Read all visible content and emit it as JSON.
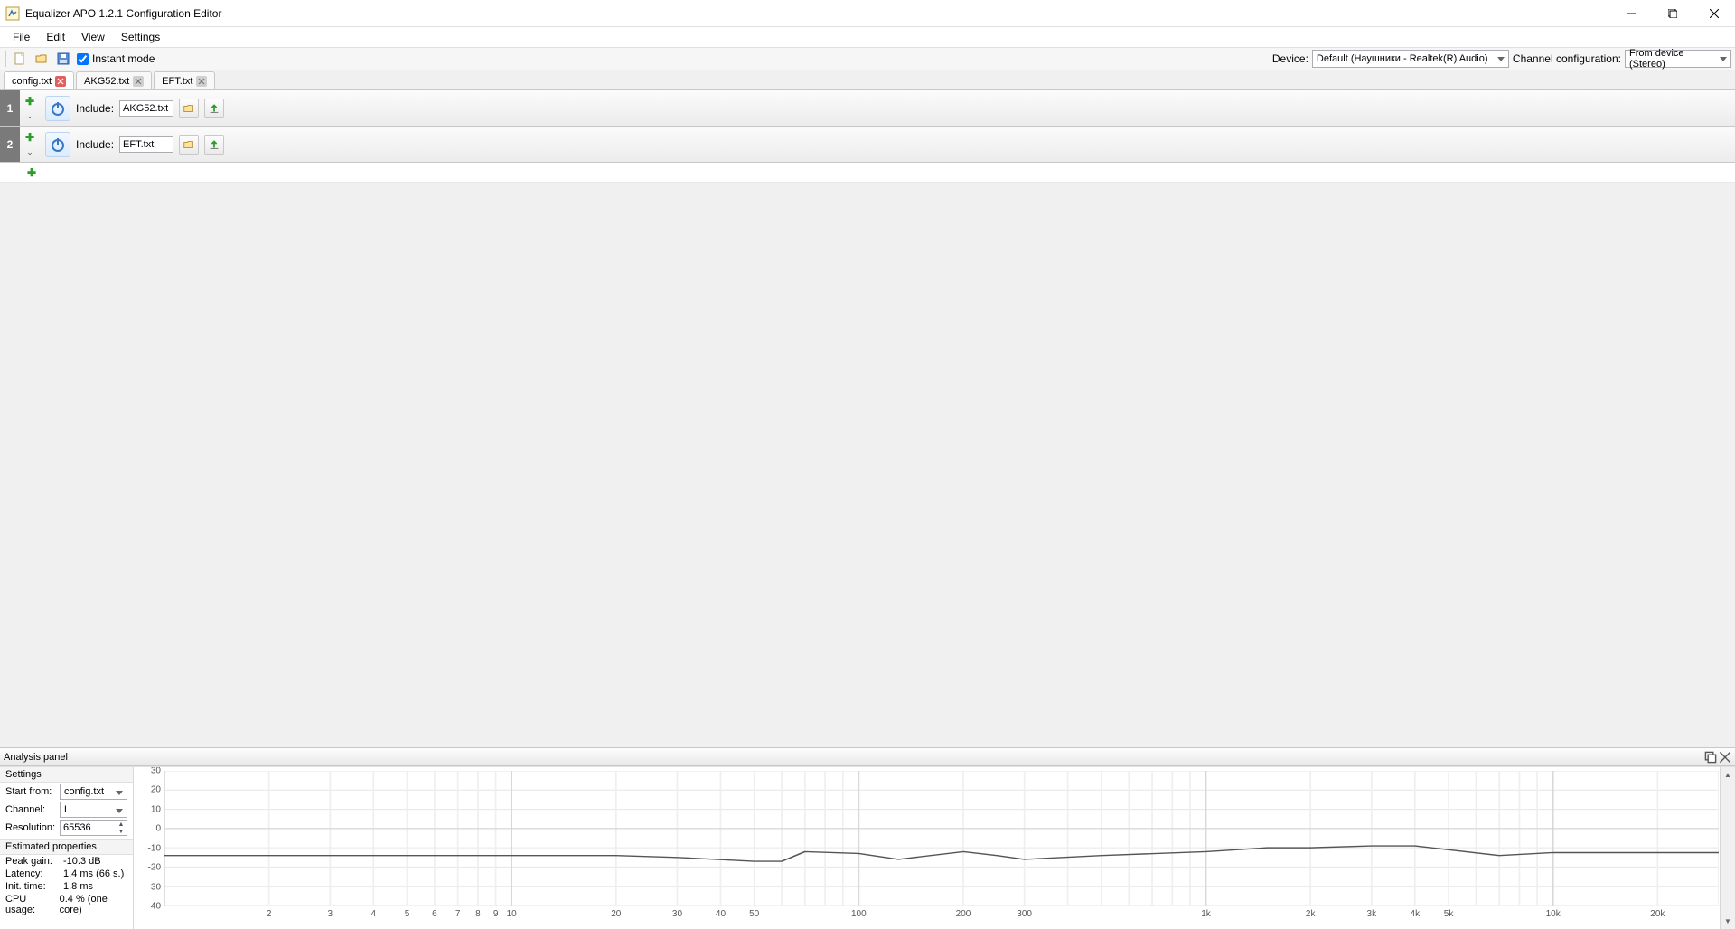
{
  "window": {
    "title": "Equalizer APO 1.2.1 Configuration Editor"
  },
  "menubar": [
    "File",
    "Edit",
    "View",
    "Settings"
  ],
  "toolbar": {
    "instant_mode_label": "Instant mode",
    "instant_mode_checked": true,
    "device_label": "Device:",
    "device_value": "Default (Наушники - Realtek(R) Audio)",
    "channel_cfg_label": "Channel configuration:",
    "channel_cfg_value": "From device (Stereo)"
  },
  "tabs": [
    {
      "label": "config.txt",
      "active": true,
      "close_style": "red"
    },
    {
      "label": "AKG52.txt",
      "active": false,
      "close_style": "grey"
    },
    {
      "label": "EFT.txt",
      "active": false,
      "close_style": "grey"
    }
  ],
  "rows": [
    {
      "num": "1",
      "label": "Include:",
      "value": "AKG52.txt"
    },
    {
      "num": "2",
      "label": "Include:",
      "value": "EFT.txt"
    }
  ],
  "analysis": {
    "title": "Analysis panel",
    "settings_head": "Settings",
    "start_from_label": "Start from:",
    "start_from_value": "config.txt",
    "channel_label": "Channel:",
    "channel_value": "L",
    "resolution_label": "Resolution:",
    "resolution_value": "65536",
    "estimated_head": "Estimated properties",
    "props": [
      {
        "k": "Peak gain:",
        "v": "-10.3 dB"
      },
      {
        "k": "Latency:",
        "v": "1.4 ms (66 s.)"
      },
      {
        "k": "Init. time:",
        "v": "1.8 ms"
      },
      {
        "k": "CPU usage:",
        "v": "0.4 % (one core)"
      }
    ]
  },
  "chart_data": {
    "type": "line",
    "xscale": "log",
    "xlabel": "",
    "ylabel": "",
    "ylim": [
      -40,
      30
    ],
    "y_ticks": [
      30,
      20,
      10,
      0,
      -10,
      -20,
      -30,
      -40
    ],
    "x_ticks": [
      2,
      3,
      4,
      5,
      6,
      7,
      8,
      9,
      10,
      20,
      30,
      40,
      50,
      100,
      200,
      300,
      "1k",
      "2k",
      "3k",
      "4k",
      "5k",
      "10k",
      "20k"
    ],
    "x": [
      1,
      20,
      30,
      50,
      60,
      70,
      100,
      130,
      200,
      250,
      300,
      500,
      1000,
      1500,
      2000,
      3000,
      4000,
      5000,
      7000,
      10000,
      20000,
      30000
    ],
    "y": [
      -14,
      -14,
      -15,
      -17,
      -17,
      -12,
      -13,
      -16,
      -12,
      -14,
      -16,
      -14,
      -12,
      -10,
      -10,
      -9,
      -9,
      -11,
      -14,
      -12.5,
      -12.5,
      -12.5
    ]
  }
}
